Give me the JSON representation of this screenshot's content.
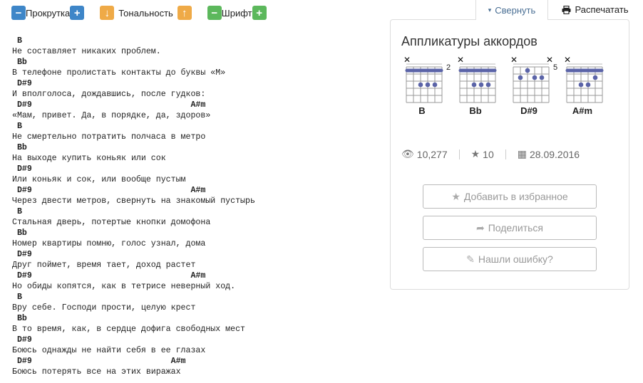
{
  "toolbar": {
    "scroll": {
      "label": "Прокрутка",
      "minus": "−",
      "plus": "+"
    },
    "key": {
      "label": "Тональность",
      "down": "↓",
      "up": "↑"
    },
    "font": {
      "label": "Шрифт",
      "minus": "−",
      "plus": "+"
    }
  },
  "tabs": {
    "collapse": {
      "label": "Свернуть",
      "icon": "▾"
    },
    "print": {
      "label": "Распечатать",
      "icon": "🖶"
    }
  },
  "lyrics": [
    {
      "chords": " B",
      "text": "Не составляет никаких проблем."
    },
    {
      "chords": " Bb",
      "text": "В телефоне пролистать контакты до буквы «М»"
    },
    {
      "chords": " D#9",
      "text": "И вполголоса, дождавшись, после гудков:"
    },
    {
      "chords": " D#9                                A#m",
      "text": "«Мам, привет. Да, в порядке, да, здоров»"
    },
    {
      "chords": " B",
      "text": "Не смертельно потратить полчаса в метро"
    },
    {
      "chords": " Bb",
      "text": "На выходе купить коньяк или сок"
    },
    {
      "chords": " D#9",
      "text": "Или коньяк и сок, или вообще пустым"
    },
    {
      "chords": " D#9                                A#m",
      "text": "Через двести метров, свернуть на знакомый пустырь"
    },
    {
      "chords": " B",
      "text": "Стальная дверь, потертые кнопки домофона"
    },
    {
      "chords": " Bb",
      "text": "Номер квартиры помню, голос узнал, дома"
    },
    {
      "chords": " D#9",
      "text": "Друг поймет, время тает, доход растет"
    },
    {
      "chords": " D#9                                A#m",
      "text": "Но обиды копятся, как в тетрисе неверный ход."
    },
    {
      "chords": " B",
      "text": "Вру себе. Господи прости, целую крест"
    },
    {
      "chords": " Bb",
      "text": "В то время, как, в сердце дофига свободных мест"
    },
    {
      "chords": " D#9",
      "text": "Боюсь однажды не найти себя в ее глазах"
    },
    {
      "chords": " D#9                            A#m",
      "text": "Боюсь потерять все на этих виражах"
    }
  ],
  "panel": {
    "title": "Аппликатуры аккордов",
    "chords": [
      {
        "name": "B",
        "fret": "2",
        "muted": [
          0
        ],
        "barre": true,
        "dots": [
          [
            2,
            2
          ],
          [
            2,
            3
          ],
          [
            2,
            4
          ]
        ]
      },
      {
        "name": "Bb",
        "fret": "",
        "muted": [
          0
        ],
        "barre": true,
        "dots": [
          [
            2,
            2
          ],
          [
            2,
            3
          ],
          [
            2,
            4
          ]
        ]
      },
      {
        "name": "D#9",
        "fret": "5",
        "muted": [
          0,
          5
        ],
        "barre": false,
        "dots": [
          [
            0,
            2
          ],
          [
            1,
            1
          ],
          [
            1,
            3
          ],
          [
            1,
            4
          ]
        ]
      },
      {
        "name": "A#m",
        "fret": "",
        "muted": [
          0
        ],
        "barre": true,
        "dots": [
          [
            1,
            4
          ],
          [
            2,
            2
          ],
          [
            2,
            3
          ]
        ]
      }
    ],
    "stats": {
      "views": "10,277",
      "stars": "10",
      "date": "28.09.2016"
    },
    "buttons": {
      "favorite": "Добавить в избранное",
      "share": "Поделиться",
      "error": "Нашли ошибку?"
    }
  }
}
